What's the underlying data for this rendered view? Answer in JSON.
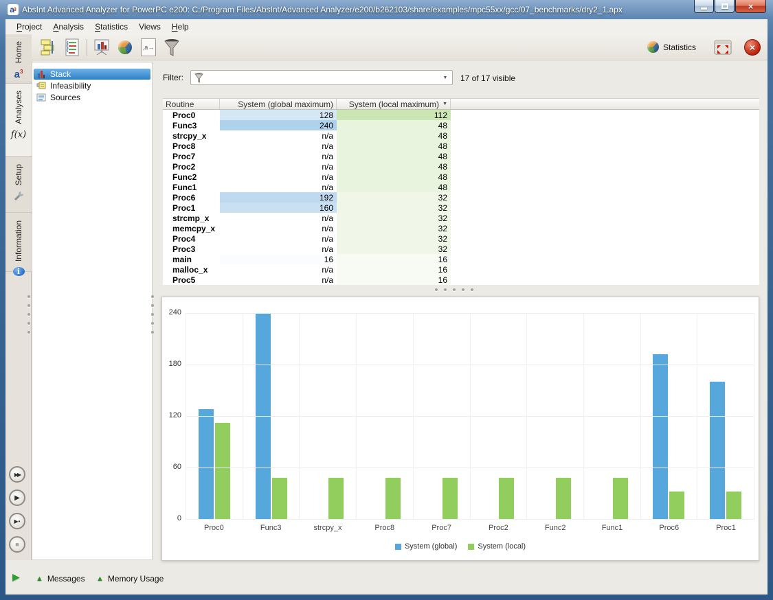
{
  "window": {
    "title": "AbsInt Advanced Analyzer for PowerPC e200: C:/Program Files/AbsInt/Advanced Analyzer/e200/b262103/share/examples/mpc55xx/gcc/07_benchmarks/dry2_1.apx",
    "logo": {
      "letter": "a",
      "sup": "3"
    },
    "close_glyph": "×"
  },
  "menubar": {
    "items": [
      {
        "label": "Project",
        "accel": 0
      },
      {
        "label": "Analysis",
        "accel": 0
      },
      {
        "label": "Statistics",
        "accel": 0
      },
      {
        "label": "Views",
        "accel": -1
      },
      {
        "label": "Help",
        "accel": 0
      }
    ]
  },
  "toolbar": {
    "statistics_label": "Statistics",
    "export_icon_text": ",a",
    "close_glyph": "×"
  },
  "sidebar": {
    "tabs": [
      {
        "label": "Home"
      },
      {
        "label": "Analyses",
        "icon_text": "f(x)",
        "active": true
      },
      {
        "label": "Setup"
      },
      {
        "label": "Information",
        "icon_letter": "i"
      }
    ],
    "views": [
      {
        "label": "Stack",
        "selected": true
      },
      {
        "label": "Infeasibility"
      },
      {
        "label": "Sources"
      }
    ]
  },
  "filter": {
    "label": "Filter:",
    "value": "",
    "status": "17 of 17 visible"
  },
  "table": {
    "columns": [
      {
        "label": "Routine"
      },
      {
        "label": "System (global maximum)"
      },
      {
        "label": "System (local maximum)",
        "sort": "desc"
      }
    ],
    "sort_arrow": "▼",
    "na_text": "n/a",
    "rows": [
      {
        "routine": "Proc0",
        "global": 128,
        "local": 112
      },
      {
        "routine": "Func3",
        "global": 240,
        "local": 48
      },
      {
        "routine": "strcpy_x",
        "global": null,
        "local": 48
      },
      {
        "routine": "Proc8",
        "global": null,
        "local": 48
      },
      {
        "routine": "Proc7",
        "global": null,
        "local": 48
      },
      {
        "routine": "Proc2",
        "global": null,
        "local": 48
      },
      {
        "routine": "Func2",
        "global": null,
        "local": 48
      },
      {
        "routine": "Func1",
        "global": null,
        "local": 48
      },
      {
        "routine": "Proc6",
        "global": 192,
        "local": 32
      },
      {
        "routine": "Proc1",
        "global": 160,
        "local": 32
      },
      {
        "routine": "strcmp_x",
        "global": null,
        "local": 32
      },
      {
        "routine": "memcpy_x",
        "global": null,
        "local": 32
      },
      {
        "routine": "Proc4",
        "global": null,
        "local": 32
      },
      {
        "routine": "Proc3",
        "global": null,
        "local": 32
      },
      {
        "routine": "main",
        "global": 16,
        "local": 16
      },
      {
        "routine": "malloc_x",
        "global": null,
        "local": 16
      },
      {
        "routine": "Proc5",
        "global": null,
        "local": 16
      }
    ],
    "value_colors": {
      "global_rgb": "88,160,216",
      "local_rgb": "146,200,96",
      "global_max": 240,
      "local_max": 112
    }
  },
  "chart_data": {
    "type": "bar",
    "categories": [
      "Proc0",
      "Func3",
      "strcpy_x",
      "Proc8",
      "Proc7",
      "Proc2",
      "Func2",
      "Func1",
      "Proc6",
      "Proc1"
    ],
    "series": [
      {
        "name": "System (global)",
        "color": "#56a8dc",
        "values": [
          128,
          240,
          null,
          null,
          null,
          null,
          null,
          null,
          192,
          160
        ]
      },
      {
        "name": "System (local)",
        "color": "#92ce5e",
        "values": [
          112,
          48,
          48,
          48,
          48,
          48,
          48,
          48,
          32,
          32
        ]
      }
    ],
    "ylim": [
      0,
      240
    ],
    "yticks": [
      240,
      180,
      120,
      60,
      0
    ],
    "grid": true,
    "legend_position": "bottom"
  },
  "transport": [
    {
      "name": "run-all-button",
      "glyph_text": "▶▶",
      "cls": "g-ff"
    },
    {
      "name": "run-button",
      "glyph_text": "▶",
      "cls": "g-play"
    },
    {
      "name": "run-step-button",
      "glyph_text": "▶•",
      "cls": "g-step"
    },
    {
      "name": "stop-button",
      "glyph_text": "■",
      "cls": "g-stop",
      "disabled": true
    }
  ],
  "statusbar": {
    "run_glyph": "▶",
    "toggle_glyph": "▲",
    "messages_label": "Messages",
    "memory_label": "Memory Usage"
  },
  "combo_arrow": "▼"
}
